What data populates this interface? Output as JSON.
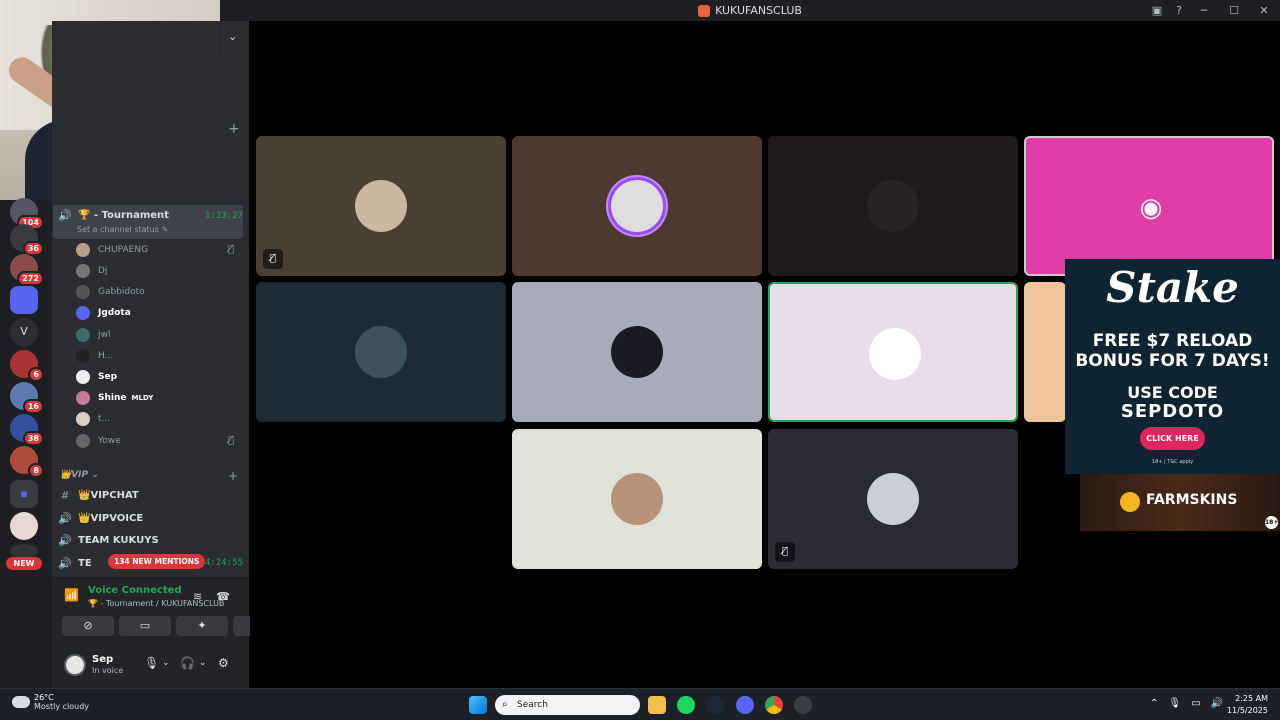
{
  "window": {
    "title": "KUKUFANSCLUB"
  },
  "rail": {
    "badges": [
      "104",
      "36",
      "272",
      "6",
      "16",
      "38",
      "8"
    ],
    "letter_item": "V",
    "new_label": "NEW"
  },
  "channel": {
    "selected_name": "🏆 - Tournament",
    "timer": "1:33:27",
    "status_placeholder": "Set a channel status ✎",
    "members": [
      "CHUPAENG",
      "Dj",
      "Gabbidoto",
      "Jgdota",
      "jwl",
      "H...",
      "Sep",
      "Shine",
      "t...",
      "Yowe"
    ],
    "shine_tag": "MLDY",
    "vip_header": "VIP",
    "vip_channels": [
      "👑VIPCHAT",
      "👑VIPVOICE",
      "TEAM KUKUYS",
      "TE"
    ],
    "last_timer": "4:24:55",
    "mentions_label": "134 NEW MENTIONS"
  },
  "voice": {
    "title": "Voice Connected",
    "subtitle": "🏆 - Tournament / KUKUFANSCLUB"
  },
  "user": {
    "name": "Sep",
    "status": "In voice"
  },
  "ads": {
    "stake": {
      "logo": "Stake",
      "line1": "FREE $7 RELOAD",
      "line2": "BONUS FOR 7 DAYS!",
      "line3": "USE CODE",
      "line4": "SEPDOTO",
      "button": "CLICK HERE",
      "tc": "18+ | T&C apply"
    },
    "farmskins": {
      "label": "FARMSKINS",
      "age": "18+"
    }
  },
  "taskbar": {
    "temp": "26°C",
    "condition": "Mostly cloudy",
    "search_placeholder": "Search",
    "time": "2:25 AM",
    "date": "11/5/2025"
  },
  "colors": {
    "accent_green": "#23a55a",
    "danger_red": "#da373c",
    "discord_tile_pink": "#e03ca8"
  }
}
